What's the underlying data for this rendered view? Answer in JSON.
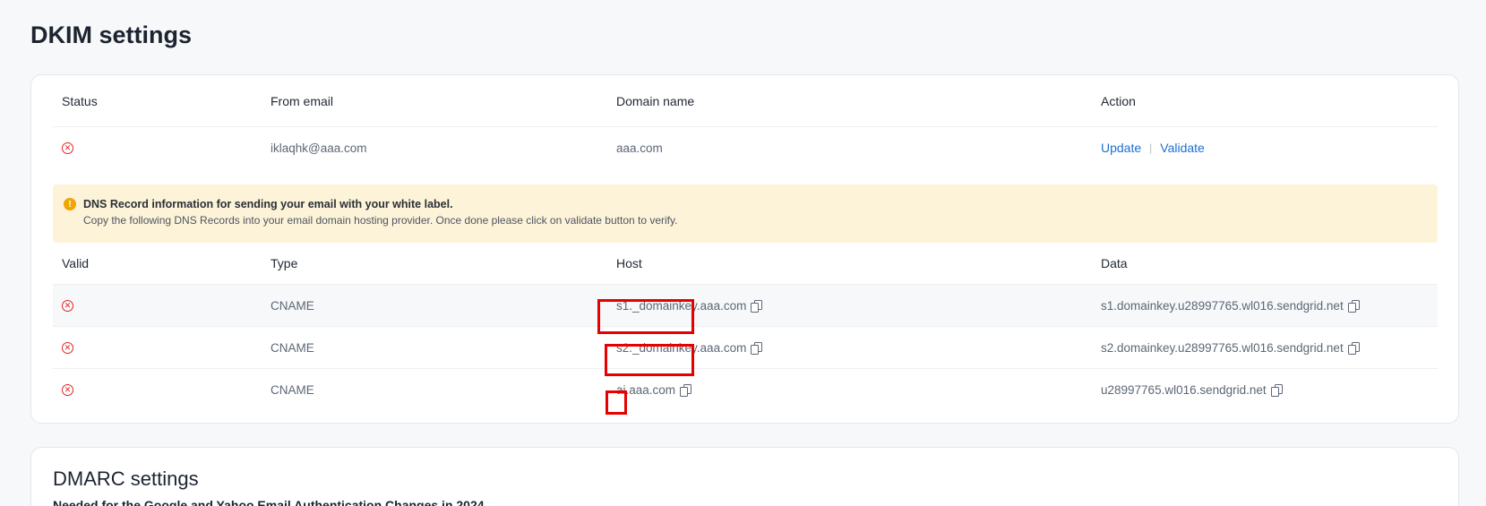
{
  "page": {
    "title": "DKIM settings"
  },
  "dkim": {
    "headers": {
      "status": "Status",
      "from_email": "From email",
      "domain_name": "Domain name",
      "action": "Action"
    },
    "record": {
      "from_email": "iklaqhk@aaa.com",
      "domain_name": "aaa.com",
      "status_icon": "error-circle-icon",
      "actions": {
        "update": "Update",
        "separator": "|",
        "validate": "Validate"
      }
    }
  },
  "notice": {
    "title": "DNS Record information for sending your email with your white label.",
    "body": "Copy the following DNS Records into your email domain hosting provider. Once done please click on validate button to verify."
  },
  "dns": {
    "headers": {
      "valid": "Valid",
      "type": "Type",
      "host": "Host",
      "data": "Data"
    },
    "rows": [
      {
        "type": "CNAME",
        "host": "s1._domainkey.aaa.com",
        "data": "s1.domainkey.u28997765.wl016.sendgrid.net"
      },
      {
        "type": "CNAME",
        "host": "s2._domainkey.aaa.com",
        "data": "s2.domainkey.u28997765.wl016.sendgrid.net"
      },
      {
        "type": "CNAME",
        "host": "ai.aaa.com",
        "data": "u28997765.wl016.sendgrid.net"
      }
    ]
  },
  "dmarc": {
    "title": "DMARC settings",
    "subtitle": "Needed for the Google and Yahoo Email Authentication Changes in 2024"
  },
  "colors": {
    "error": "#e02424",
    "link": "#1a6fd4",
    "notice_bg": "#fdf3d8",
    "highlight": "#e60000"
  }
}
